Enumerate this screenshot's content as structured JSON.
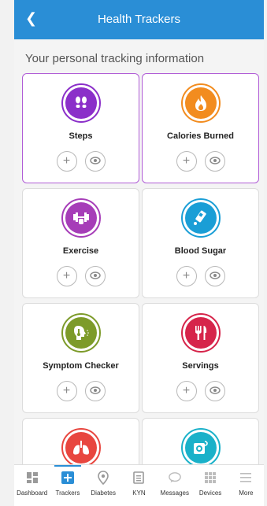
{
  "header": {
    "title": "Health Trackers",
    "back_icon": "chevron-left-icon"
  },
  "subtitle": "Your personal tracking information",
  "colors": {
    "primary": "#2a8ed6",
    "selected_border": "#b05cd6"
  },
  "cards": [
    {
      "label": "Steps",
      "icon": "footprints-icon",
      "color": "#8b2fc9",
      "selected": true
    },
    {
      "label": "Calories Burned",
      "icon": "flame-icon",
      "color": "#f28c1f",
      "selected": true
    },
    {
      "label": "Exercise",
      "icon": "dumbbell-icon",
      "color": "#a63db8",
      "selected": false
    },
    {
      "label": "Blood Sugar",
      "icon": "glucose-meter-icon",
      "color": "#1a9ed6",
      "selected": false
    },
    {
      "label": "Symptom Checker",
      "icon": "thermometer-head-icon",
      "color": "#7d9b2a",
      "selected": false
    },
    {
      "label": "Servings",
      "icon": "fork-knife-icon",
      "color": "#d6244a",
      "selected": false
    },
    {
      "label": "",
      "icon": "lungs-icon",
      "color": "#e8463f",
      "selected": false
    },
    {
      "label": "",
      "icon": "blood-pressure-icon",
      "color": "#1ab1c9",
      "selected": false
    }
  ],
  "tabs": [
    {
      "label": "Dashboard",
      "icon": "dashboard-icon",
      "active": false
    },
    {
      "label": "Trackers",
      "icon": "plus-square-icon",
      "active": true
    },
    {
      "label": "Diabetes",
      "icon": "location-pin-icon",
      "active": false
    },
    {
      "label": "KYN",
      "icon": "document-icon",
      "active": false
    },
    {
      "label": "Messages",
      "icon": "chat-icon",
      "active": false
    },
    {
      "label": "Devices",
      "icon": "grid-icon",
      "active": false
    },
    {
      "label": "More",
      "icon": "menu-icon",
      "active": false
    }
  ]
}
